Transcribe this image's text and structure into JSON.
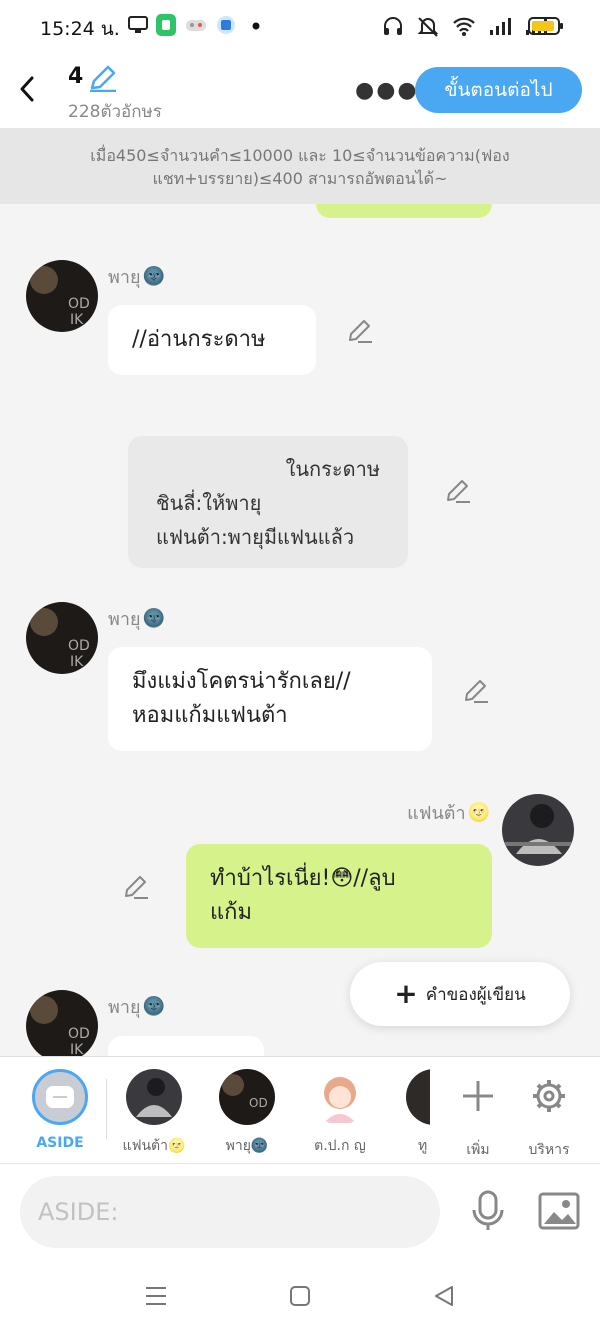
{
  "status_bar": {
    "time": "15:24 น."
  },
  "header": {
    "title": "4",
    "char_count": "228ตัวอักษร",
    "more_icon": "more-horizontal-icon",
    "next_button": "ขั้นตอนต่อไป"
  },
  "notice": "เมื่อ450≤จำนวนคำ≤10000 และ 10≤จำนวนข้อความ(ฟองแชท+บรรยาย)≤400 สามารถอัพตอนได้~",
  "messages": [
    {
      "speaker": "พายุ",
      "speaker_emoji": "🌚",
      "text": "//อ่านกระดาษ"
    },
    {
      "narration_line1": "ในกระดาษ",
      "narration_line2": "ชินลี่:ให้พายุ",
      "narration_line3": "แฟนต้า:พายุมีแฟนแล้ว"
    },
    {
      "speaker": "พายุ",
      "speaker_emoji": "🌚",
      "line1": "มึงแม่งโคตรน่ารักเลย//",
      "line2": "หอมแก้มแฟนต้า"
    },
    {
      "speaker": "แฟนต้า",
      "speaker_emoji": "🌝",
      "line1": "ทำบ้าไรเนี่ย!😳//ลูบ",
      "line2": "แก้ม"
    },
    {
      "speaker": "พายุ",
      "speaker_emoji": "🌚"
    }
  ],
  "fab": {
    "label": "คำของผู้เขียน"
  },
  "character_bar": {
    "aside": "ASIDE",
    "chars": [
      "แฟนต้า🌝",
      "พายุ🌚",
      "ต.ป.ก ญ",
      "ทู"
    ],
    "add": "เพิ่ม",
    "manage": "บริหาร"
  },
  "input": {
    "placeholder": "ASIDE:"
  },
  "colors": {
    "accent": "#4aa8f3",
    "green_bubble": "#d5f38a",
    "aside_blue": "#4aa8f3"
  }
}
